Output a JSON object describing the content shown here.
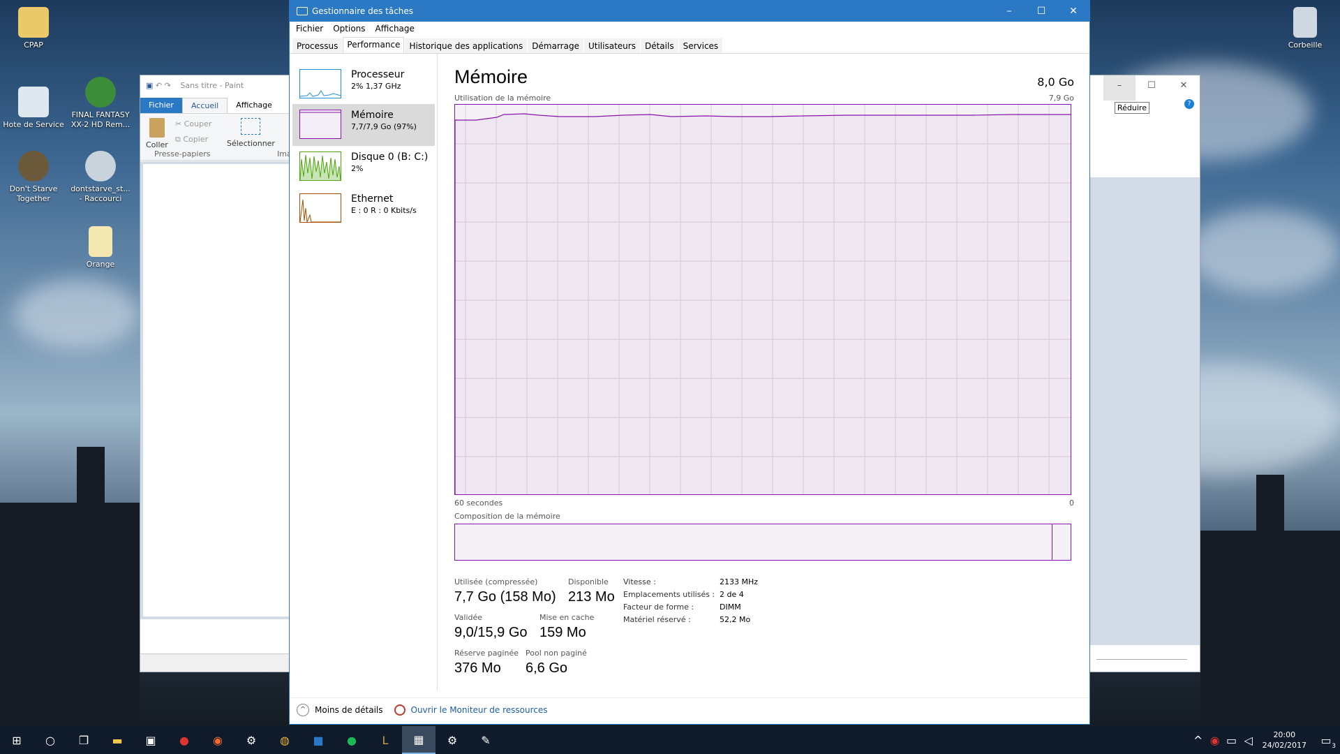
{
  "desktop": {
    "icons": [
      {
        "label": "CPAP"
      },
      {
        "label": "Hote de Service"
      },
      {
        "label": "FINAL FANTASY XX-2 HD Rem..."
      },
      {
        "label": "Don't Starve Together"
      },
      {
        "label": "dontstarve_st... - Raccourci"
      },
      {
        "label": "Orange"
      },
      {
        "label": "Corbeille"
      }
    ]
  },
  "paint": {
    "quick_access_title": "Sans titre - Paint",
    "ribbon_tabs": {
      "fichier": "Fichier",
      "accueil": "Accueil",
      "affichage": "Affichage"
    },
    "coller": "Coller",
    "couper": "Couper",
    "copier": "Copier",
    "selectionner": "Sélectionner",
    "group_clipboard": "Presse-papiers",
    "group_image": "Ima"
  },
  "right_window": {
    "tooltip": "Réduire"
  },
  "taskmgr": {
    "title": "Gestionnaire des tâches",
    "menu": {
      "fichier": "Fichier",
      "options": "Options",
      "affichage": "Affichage"
    },
    "tabs": [
      "Processus",
      "Performance",
      "Historique des applications",
      "Démarrage",
      "Utilisateurs",
      "Détails",
      "Services"
    ],
    "sidebar": [
      {
        "name": "Processeur",
        "sub": "2% 1,37 GHz",
        "color": "#1d8fdb"
      },
      {
        "name": "Mémoire",
        "sub": "7,7/7,9 Go (97%)",
        "color": "#8b12ae"
      },
      {
        "name": "Disque 0 (B: C:)",
        "sub": "2%",
        "color": "#4da60c"
      },
      {
        "name": "Ethernet",
        "sub": "E : 0 R : 0 Kbits/s",
        "color": "#a74f01"
      }
    ],
    "main": {
      "title": "Mémoire",
      "capacity": "8,0 Go",
      "usage_label": "Utilisation de la mémoire",
      "usage_max": "7,9 Go",
      "x_left": "60 secondes",
      "x_right": "0",
      "composition_label": "Composition de la mémoire",
      "usage_percent": 97,
      "stats": {
        "used_label": "Utilisée (compressée)",
        "used": "7,7 Go (158 Mo)",
        "avail_label": "Disponible",
        "avail": "213 Mo",
        "committed_label": "Validée",
        "committed": "9,0/15,9 Go",
        "cached_label": "Mise en cache",
        "cached": "159 Mo",
        "paged_label": "Réserve paginée",
        "paged": "376 Mo",
        "nonpaged_label": "Pool non paginé",
        "nonpaged": "6,6 Go"
      },
      "details": {
        "speed_label": "Vitesse :",
        "speed": "2133 MHz",
        "slots_label": "Emplacements utilisés :",
        "slots": "2 de 4",
        "form_label": "Facteur de forme :",
        "form": "DIMM",
        "hw_label": "Matériel réservé :",
        "hw": "52,2 Mo"
      }
    },
    "footer": {
      "less": "Moins de détails",
      "monitor": "Ouvrir le Moniteur de ressources"
    }
  },
  "taskbar": {
    "time": "20:00",
    "date": "24/02/2017",
    "notif": "3"
  }
}
